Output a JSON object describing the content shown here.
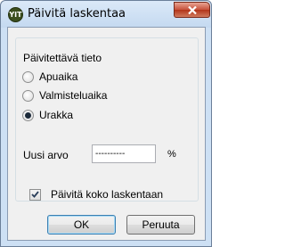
{
  "window": {
    "title": "Päivitä laskentaa",
    "icon_text": "YIT"
  },
  "group": {
    "label": "Päivitettävä tieto",
    "options": [
      {
        "label": "Apuaika",
        "selected": false
      },
      {
        "label": "Valmisteluaika",
        "selected": false
      },
      {
        "label": "Urakka",
        "selected": true
      }
    ]
  },
  "value": {
    "label": "Uusi arvo",
    "input_value": "----------",
    "unit": "%"
  },
  "checkbox": {
    "label": "Päivitä koko laskentaan",
    "checked": true
  },
  "buttons": {
    "ok": "OK",
    "cancel": "Peruuta"
  }
}
